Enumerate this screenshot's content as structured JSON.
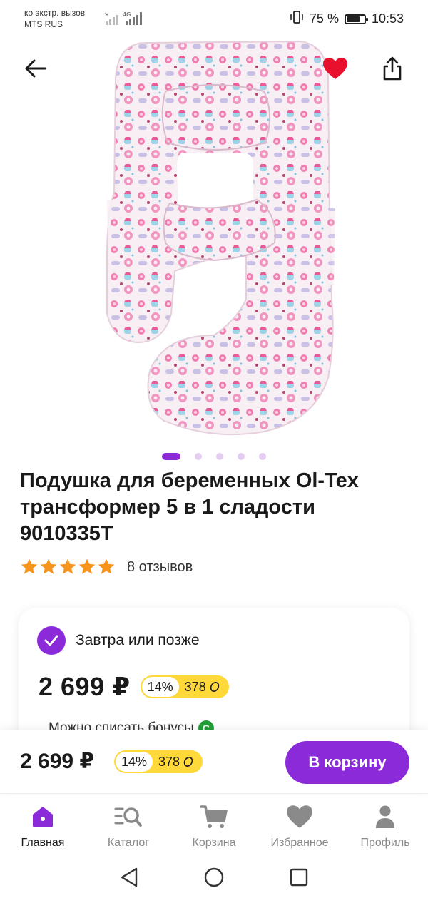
{
  "status_bar": {
    "line1": "ко экстр. вызов",
    "line2": "MTS RUS",
    "network": "4G",
    "battery_pct": "75 %",
    "battery_level": 0.75,
    "time": "10:53"
  },
  "product": {
    "title": "Подушка для беременных Ol-Tex трансформер 5 в 1 сладости 9010335T",
    "image_count": 5,
    "active_image": 1,
    "rating": 5,
    "reviews": "8 отзывов",
    "favorited": true
  },
  "delivery_card": {
    "delivery_text": "Завтра или позже",
    "price": "2 699 ₽",
    "bonus_percent": "14%",
    "bonus_amount": "378",
    "writeoff_text": "Можно списать бонусы",
    "writeoff_icon": "С"
  },
  "buy_bar": {
    "price": "2 699 ₽",
    "bonus_percent": "14%",
    "bonus_amount": "378",
    "cart_button": "В корзину"
  },
  "nav": {
    "items": [
      {
        "label": "Главная",
        "icon": "home-icon",
        "active": true
      },
      {
        "label": "Каталог",
        "icon": "catalog-icon",
        "active": false
      },
      {
        "label": "Корзина",
        "icon": "cart-icon",
        "active": false
      },
      {
        "label": "Избранное",
        "icon": "heart-icon",
        "active": false
      },
      {
        "label": "Профиль",
        "icon": "profile-icon",
        "active": false
      }
    ]
  },
  "colors": {
    "accent": "#8b2ad9",
    "bonus": "#ffd83a",
    "favorite": "#e8102c",
    "star": "#f7941d",
    "pillow_base": "#f6eef3",
    "pillow_pattern": "#e96aa1"
  }
}
